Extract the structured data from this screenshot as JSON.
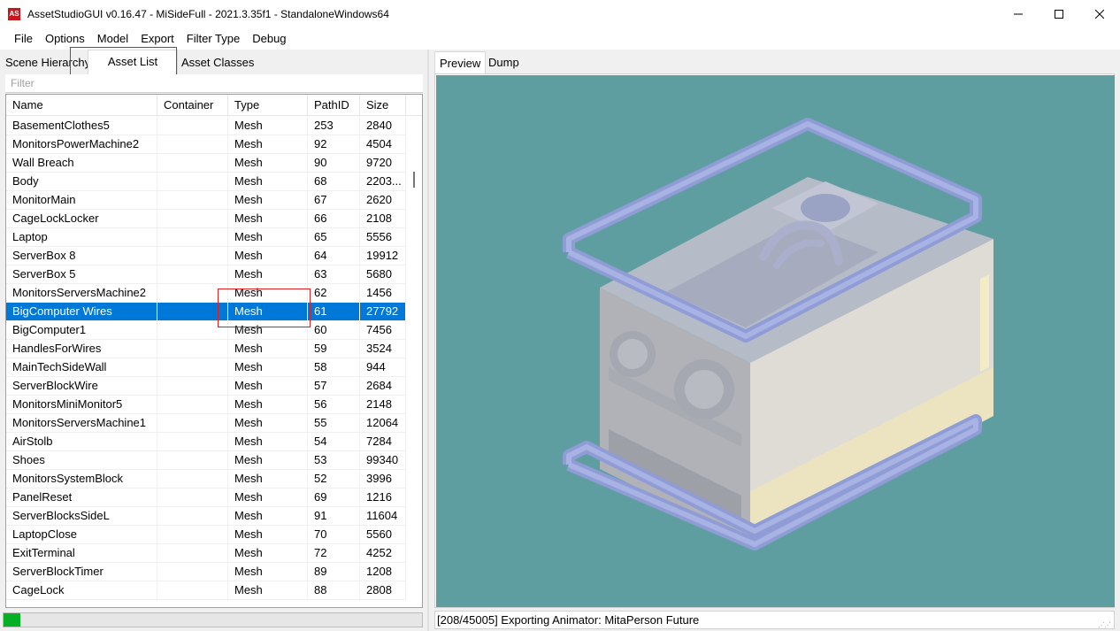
{
  "window": {
    "icon_text": "AS",
    "title": "AssetStudioGUI v0.16.47 - MiSideFull - 2021.3.35f1 - StandaloneWindows64"
  },
  "menu": [
    "File",
    "Options",
    "Model",
    "Export",
    "Filter Type",
    "Debug"
  ],
  "left_tabs": {
    "scene": "Scene Hierarchy",
    "assets": "Asset List",
    "classes": "Asset Classes"
  },
  "filter": {
    "placeholder": "Filter"
  },
  "table": {
    "columns": [
      "Name",
      "Container",
      "Type",
      "PathID",
      "Size"
    ],
    "rows": [
      [
        "BasementClothes5",
        "",
        "Mesh",
        "253",
        "2840"
      ],
      [
        "MonitorsPowerMachine2",
        "",
        "Mesh",
        "92",
        "4504"
      ],
      [
        "Wall Breach",
        "",
        "Mesh",
        "90",
        "9720"
      ],
      [
        "Body",
        "",
        "Mesh",
        "68",
        "2203..."
      ],
      [
        "MonitorMain",
        "",
        "Mesh",
        "67",
        "2620"
      ],
      [
        "CageLockLocker",
        "",
        "Mesh",
        "66",
        "2108"
      ],
      [
        "Laptop",
        "",
        "Mesh",
        "65",
        "5556"
      ],
      [
        "ServerBox 8",
        "",
        "Mesh",
        "64",
        "19912"
      ],
      [
        "ServerBox 5",
        "",
        "Mesh",
        "63",
        "5680"
      ],
      [
        "MonitorsServersMachine2",
        "",
        "Mesh",
        "62",
        "1456"
      ],
      [
        "BigComputer Wires",
        "",
        "Mesh",
        "61",
        "27792"
      ],
      [
        "BigComputer1",
        "",
        "Mesh",
        "60",
        "7456"
      ],
      [
        "HandlesForWires",
        "",
        "Mesh",
        "59",
        "3524"
      ],
      [
        "MainTechSideWall",
        "",
        "Mesh",
        "58",
        "944"
      ],
      [
        "ServerBlockWire",
        "",
        "Mesh",
        "57",
        "2684"
      ],
      [
        "MonitorsMiniMonitor5",
        "",
        "Mesh",
        "56",
        "2148"
      ],
      [
        "MonitorsServersMachine1",
        "",
        "Mesh",
        "55",
        "12064"
      ],
      [
        "AirStolb",
        "",
        "Mesh",
        "54",
        "7284"
      ],
      [
        "Shoes",
        "",
        "Mesh",
        "53",
        "99340"
      ],
      [
        "MonitorsSystemBlock",
        "",
        "Mesh",
        "52",
        "3996"
      ],
      [
        "PanelReset",
        "",
        "Mesh",
        "69",
        "1216"
      ],
      [
        "ServerBlocksSideL",
        "",
        "Mesh",
        "91",
        "11604"
      ],
      [
        "LaptopClose",
        "",
        "Mesh",
        "70",
        "5560"
      ],
      [
        "ExitTerminal",
        "",
        "Mesh",
        "72",
        "4252"
      ],
      [
        "ServerBlockTimer",
        "",
        "Mesh",
        "89",
        "1208"
      ],
      [
        "CageLock",
        "",
        "Mesh",
        "88",
        "2808"
      ]
    ],
    "selected_index": 10
  },
  "progress": {
    "fraction": 0.04
  },
  "right_tabs": {
    "preview": "Preview",
    "dump": "Dump"
  },
  "status": {
    "text": "[208/45005] Exporting Animator: MitaPerson Future"
  },
  "colors": {
    "selection": "#0078d7",
    "preview_bg": "#5f9ea0",
    "highlight": "#e02020",
    "progress": "#06b025"
  }
}
